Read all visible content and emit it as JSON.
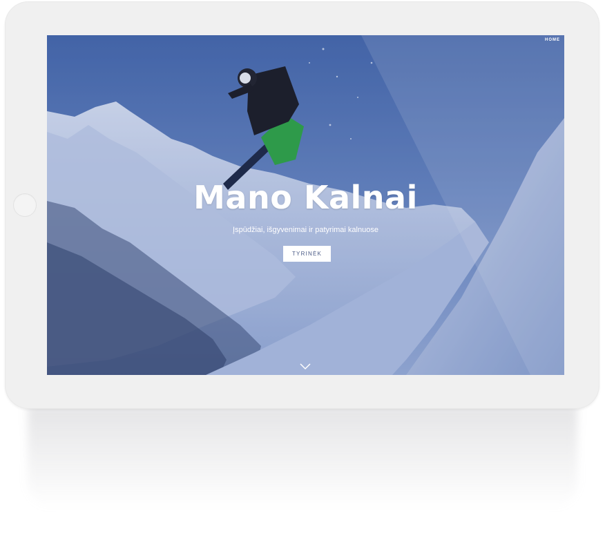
{
  "nav": {
    "home_label": "HOME"
  },
  "hero": {
    "title": "Mano Kalnai",
    "subtitle": "Įspūdžiai, išgyvenimai ir patyrimai kalnuose",
    "cta_label": "TYRINĖK",
    "scroll_icon": "chevron-down-icon"
  },
  "colors": {
    "overlay_blue": "#3c5aa0",
    "device_frame": "#f0f0f0",
    "cta_text": "#4a5a86"
  }
}
